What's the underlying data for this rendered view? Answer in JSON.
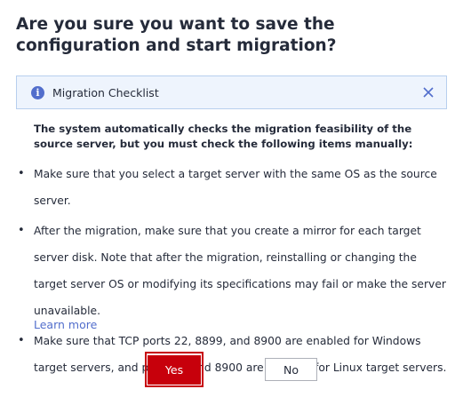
{
  "dialog": {
    "title": "Are you sure you want to save the configuration and start migration?",
    "checklist": {
      "label": "Migration Checklist",
      "info_icon": "info-icon",
      "close_icon": "close-icon"
    },
    "intro": "The system automatically checks the migration feasibility of the source server, but you must check the following items manually:",
    "items": [
      {
        "text": "Make sure that you select a target server with the same OS as the source server."
      },
      {
        "text": "After the migration, make sure that you create a mirror for each target server disk. Note that after the migration, reinstalling or changing the target server OS or modifying its specifications may fail or make the server unavailable."
      },
      {
        "text": "Make sure that TCP ports 22, 8899, and 8900 are enabled for Windows target servers, and ports 22 and 8900 are enabled for Linux target servers."
      }
    ],
    "learn_more": "Learn more",
    "buttons": {
      "yes": "Yes",
      "no": "No"
    }
  },
  "colors": {
    "primary": "#c7000b",
    "link": "#526ecc",
    "info_bg": "#eef4fd",
    "text": "#252b3a"
  }
}
